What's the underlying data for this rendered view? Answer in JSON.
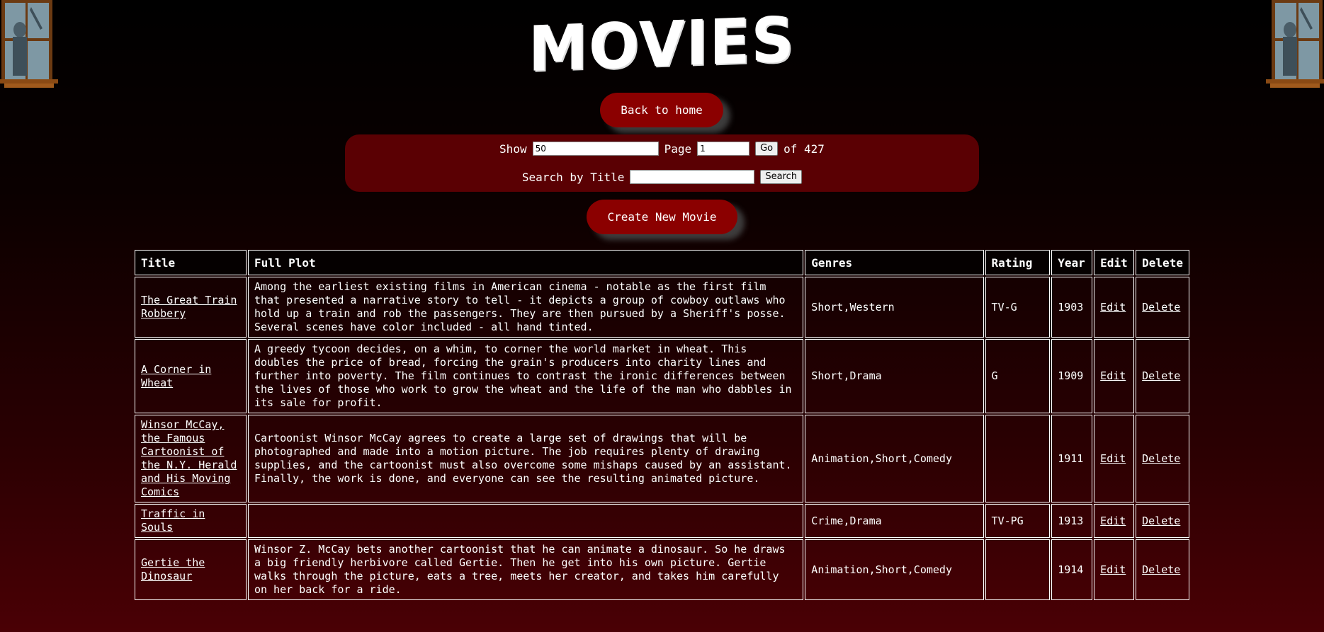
{
  "page": {
    "title": "MOVIES",
    "back_label": "Back to home",
    "create_label": "Create New Movie"
  },
  "controls": {
    "show_label": "Show",
    "show_value": "50",
    "page_label": "Page",
    "page_value": "1",
    "go_label": "Go",
    "of_label": "of 427",
    "search_label": "Search by Title",
    "search_value": "",
    "search_button": "Search"
  },
  "table": {
    "headers": [
      "Title",
      "Full Plot",
      "Genres",
      "Rating",
      "Year",
      "Edit",
      "Delete"
    ],
    "rows": [
      {
        "title": "The Great Train Robbery",
        "plot": "Among the earliest existing films in American cinema - notable as the first film that presented a narrative story to tell - it depicts a group of cowboy outlaws who hold up a train and rob the passengers. They are then pursued by a Sheriff's posse. Several scenes have color included - all hand tinted.",
        "genres": "Short,Western",
        "rating": "TV-G",
        "year": "1903",
        "edit": "Edit",
        "delete": "Delete"
      },
      {
        "title": "A Corner in Wheat",
        "plot": "A greedy tycoon decides, on a whim, to corner the world market in wheat. This doubles the price of bread, forcing the grain's producers into charity lines and further into poverty. The film continues to contrast the ironic differences between the lives of those who work to grow the wheat and the life of the man who dabbles in its sale for profit.",
        "genres": "Short,Drama",
        "rating": "G",
        "year": "1909",
        "edit": "Edit",
        "delete": "Delete"
      },
      {
        "title": "Winsor McCay, the Famous Cartoonist of the N.Y. Herald and His Moving Comics",
        "plot": "Cartoonist Winsor McCay agrees to create a large set of drawings that will be photographed and made into a motion picture. The job requires plenty of drawing supplies, and the cartoonist must also overcome some mishaps caused by an assistant. Finally, the work is done, and everyone can see the resulting animated picture.",
        "genres": "Animation,Short,Comedy",
        "rating": "",
        "year": "1911",
        "edit": "Edit",
        "delete": "Delete"
      },
      {
        "title": "Traffic in Souls",
        "plot": "",
        "genres": "Crime,Drama",
        "rating": "TV-PG",
        "year": "1913",
        "edit": "Edit",
        "delete": "Delete"
      },
      {
        "title": "Gertie the Dinosaur",
        "plot": "Winsor Z. McCay bets another cartoonist that he can animate a dinosaur. So he draws a big friendly herbivore called Gertie. Then he get into his own picture. Gertie walks through the picture, eats a tree, meets her creator, and takes him carefully on her back for a ride.",
        "genres": "Animation,Short,Comedy",
        "rating": "",
        "year": "1914",
        "edit": "Edit",
        "delete": "Delete"
      }
    ]
  }
}
